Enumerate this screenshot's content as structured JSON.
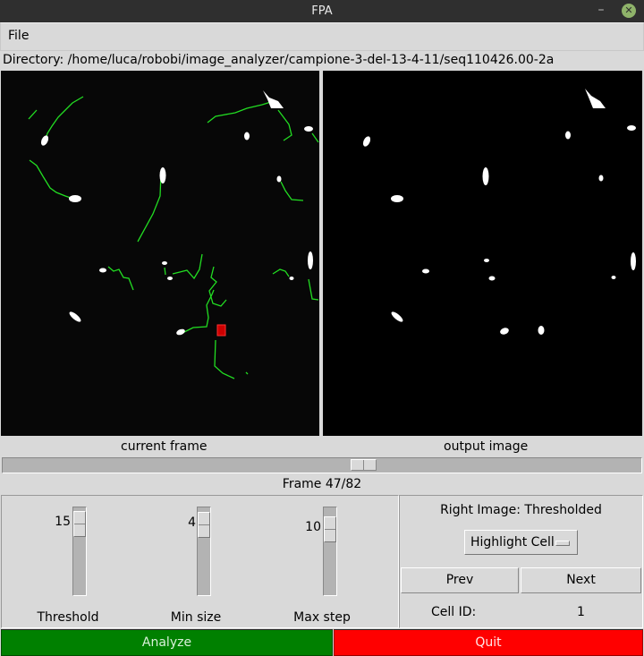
{
  "window": {
    "title": "FPA",
    "minimize_icon": "minimize-icon",
    "close_icon": "close-icon"
  },
  "menubar": {
    "items": [
      {
        "label": "File"
      }
    ]
  },
  "directory": "Directory: /home/luca/robobi/image_analyzer/campione-3-del-13-4-11/seq110426.00-2a",
  "images": {
    "left_caption": "current frame",
    "right_caption": "output image",
    "left_type": "microscope frame with green cell tracks and red highlighted cell",
    "right_type": "thresholded binary image",
    "track_color": "#22dd22",
    "highlight_color": "#cc0000"
  },
  "frame": {
    "label": "Frame 47/82",
    "current": 47,
    "total": 82
  },
  "sliders": [
    {
      "label": "Threshold",
      "value": "15",
      "fraction": 0.05
    },
    {
      "label": "Min size",
      "value": "4",
      "fraction": 0.06
    },
    {
      "label": "Max step",
      "value": "10",
      "fraction": 0.13
    }
  ],
  "right_panel": {
    "title": "Right Image: Thresholded",
    "option_menu": "Highlight Cell",
    "prev_label": "Prev",
    "next_label": "Next",
    "cell_id_label": "Cell ID:",
    "cell_id_value": "1"
  },
  "actions": {
    "analyze_label": "Analyze",
    "quit_label": "Quit",
    "analyze_color": "#008000",
    "quit_color": "#ff0000"
  }
}
